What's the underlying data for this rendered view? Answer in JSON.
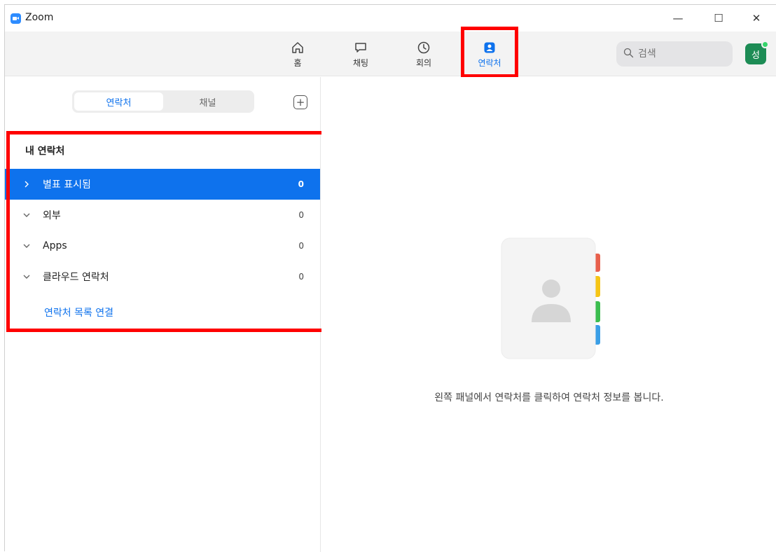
{
  "window": {
    "title": "Zoom",
    "controls": {
      "minimize": "—",
      "maximize": "☐",
      "close": "✕"
    }
  },
  "nav": {
    "tabs": [
      {
        "label": "홈",
        "icon": "home-icon"
      },
      {
        "label": "채팅",
        "icon": "chat-icon"
      },
      {
        "label": "회의",
        "icon": "clock-icon"
      },
      {
        "label": "연락처",
        "icon": "contact-icon",
        "active": true
      }
    ],
    "search_placeholder": "검색",
    "avatar_initial": "성",
    "status_color": "#35d46a"
  },
  "sidebar": {
    "segments": [
      "연락처",
      "채널"
    ],
    "active_segment": "연락처",
    "section_title": "내 연락처",
    "groups": [
      {
        "label": "별표 표시됨",
        "count": "0",
        "expanded": false,
        "selected": true
      },
      {
        "label": "외부",
        "count": "0",
        "expanded": true,
        "selected": false
      },
      {
        "label": "Apps",
        "count": "0",
        "expanded": true,
        "selected": false
      },
      {
        "label": "클라우드 연락처",
        "count": "0",
        "expanded": true,
        "selected": false
      }
    ],
    "link_label": "연락처 목록 연결"
  },
  "main": {
    "empty_state_text": "왼쪽 패널에서 연락처를 클릭하여 연락처 정보를 봅니다."
  },
  "colors": {
    "accent": "#0e72ed",
    "highlight_outline": "#ff0000",
    "nav_background": "#f3f3f3"
  }
}
